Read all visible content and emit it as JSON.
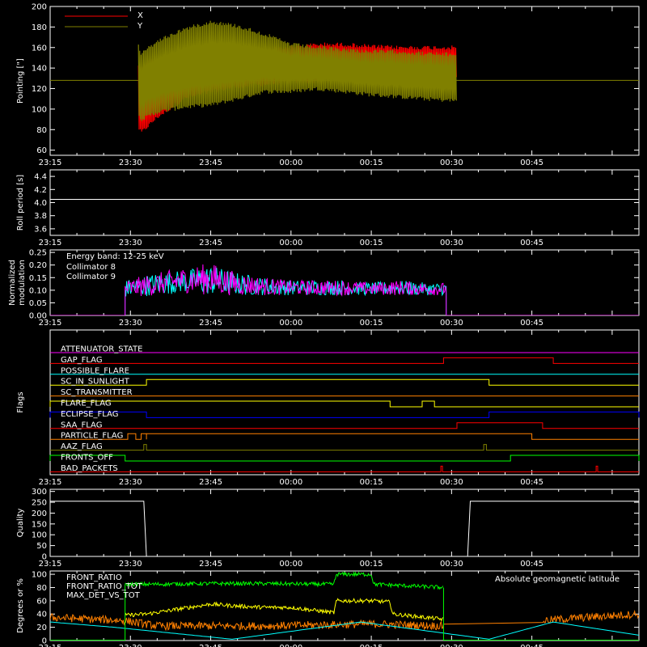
{
  "time_ticks": [
    "23:15",
    "23:30",
    "23:45",
    "00:00",
    "00:15",
    "00:30",
    "00:45"
  ],
  "chart_data": [
    {
      "type": "line",
      "ylabel": "Pointing [\"]",
      "ylim": [
        55,
        200
      ],
      "yticks": [
        60,
        80,
        100,
        120,
        140,
        160,
        180,
        200
      ],
      "xlim_minutes": [
        0,
        110
      ],
      "legend_placement": "top-left",
      "reference_line": 128,
      "series": [
        {
          "name": "X",
          "color": "#ff0000",
          "envelope": {
            "t": [
              16.5,
              17,
              18,
              20,
              25,
              30,
              35,
              40,
              45,
              50,
              55,
              60,
              65,
              70,
              76
            ],
            "low": [
              80,
              75,
              80,
              90,
              108,
              115,
              120,
              122,
              125,
              125,
              128,
              126,
              125,
              125,
              128
            ],
            "high": [
              145,
              140,
              148,
              150,
              150,
              152,
              158,
              160,
              162,
              165,
              165,
              163,
              162,
              162,
              162
            ]
          }
        },
        {
          "name": "Y",
          "color": "#808000",
          "envelope": {
            "t": [
              16.5,
              17,
              18,
              20,
              25,
              30,
              35,
              40,
              45,
              50,
              55,
              60,
              65,
              70,
              76
            ],
            "low": [
              95,
              88,
              90,
              95,
              100,
              102,
              108,
              115,
              115,
              118,
              115,
              112,
              110,
              108,
              106
            ],
            "high": [
              165,
              155,
              160,
              168,
              180,
              187,
              183,
              175,
              165,
              162,
              160,
              158,
              158,
              156,
              155
            ]
          }
        }
      ]
    },
    {
      "type": "line",
      "ylabel": "Roll period [s]",
      "ylim": [
        3.5,
        4.5
      ],
      "yticks": [
        3.6,
        3.8,
        4.0,
        4.2,
        4.4
      ],
      "xlim_minutes": [
        0,
        110
      ],
      "series": [
        {
          "name": "",
          "color": "#ffffff",
          "t": [
            0,
            110
          ],
          "values": [
            4.05,
            4.05
          ]
        }
      ]
    },
    {
      "type": "line",
      "ylabel": "Normalized modulation",
      "ylim": [
        0,
        0.26
      ],
      "yticks": [
        0.0,
        0.05,
        0.1,
        0.15,
        0.2,
        0.25
      ],
      "xlim_minutes": [
        0,
        110
      ],
      "legend_placement": "top-left",
      "annotation": "Energy band: 12-25 keV",
      "series": [
        {
          "name": "Collimator 8",
          "color": "#00ffff",
          "envelope": {
            "t": [
              14,
              20,
              25,
              30,
              35,
              40,
              45,
              50,
              55,
              60,
              65,
              70,
              74
            ],
            "low": [
              0.07,
              0.08,
              0.09,
              0.08,
              0.08,
              0.08,
              0.08,
              0.08,
              0.08,
              0.08,
              0.08,
              0.08,
              0.08
            ],
            "high": [
              0.14,
              0.17,
              0.18,
              0.2,
              0.17,
              0.15,
              0.14,
              0.14,
              0.14,
              0.13,
              0.14,
              0.13,
              0.13
            ]
          }
        },
        {
          "name": "Collimator 9",
          "color": "#ff00ff",
          "envelope": {
            "t": [
              14,
              20,
              25,
              30,
              35,
              40,
              45,
              50,
              55,
              60,
              65,
              70,
              74
            ],
            "low": [
              0.07,
              0.08,
              0.09,
              0.08,
              0.08,
              0.08,
              0.08,
              0.08,
              0.08,
              0.08,
              0.08,
              0.08,
              0.08
            ],
            "high": [
              0.14,
              0.17,
              0.19,
              0.21,
              0.17,
              0.15,
              0.14,
              0.14,
              0.14,
              0.13,
              0.14,
              0.13,
              0.13
            ]
          }
        }
      ]
    },
    {
      "type": "line",
      "ylabel": "Flags",
      "xlim_minutes": [
        0,
        110
      ],
      "series": [
        {
          "name": "ATTENUATOR_STATE",
          "color": "#ff00ff",
          "intervals": []
        },
        {
          "name": "GAP_FLAG",
          "color": "#ff0000",
          "intervals": [
            [
              73.5,
              94
            ]
          ]
        },
        {
          "name": "POSSIBLE_FLARE",
          "color": "#00ffff",
          "intervals": []
        },
        {
          "name": "SC_IN_SUNLIGHT",
          "color": "#ffff00",
          "intervals": [
            [
              18,
              82
            ]
          ]
        },
        {
          "name": "SC_TRANSMITTER",
          "color": "#ff8000",
          "intervals": []
        },
        {
          "name": "FLARE_FLAG",
          "color": "#ffff00",
          "intervals": [
            [
              0,
              63.5
            ],
            [
              69.5,
              71.8
            ]
          ]
        },
        {
          "name": "ECLIPSE_FLAG",
          "color": "#0000ff",
          "intervals": [
            [
              0,
              18
            ],
            [
              82,
              110
            ]
          ]
        },
        {
          "name": "SAA_FLAG",
          "color": "#ff0000",
          "intervals": [
            [
              76,
              92
            ]
          ]
        },
        {
          "name": "PARTICLE_FLAG",
          "color": "#ff8000",
          "intervals": [
            [
              14.5,
              16
            ],
            [
              17,
              18
            ],
            [
              18,
              90
            ]
          ]
        },
        {
          "name": "AAZ_FLAG",
          "color": "#808000",
          "intervals": [
            [
              17.5,
              18
            ],
            [
              81,
              81.5
            ]
          ]
        },
        {
          "name": "FRONTS_OFF",
          "color": "#00ff00",
          "intervals": [
            [
              0,
              14
            ],
            [
              86,
              110
            ]
          ]
        },
        {
          "name": "BAD_PACKETS",
          "color": "#ff0000",
          "intervals": [
            [
              73,
              73.3
            ],
            [
              102,
              102.3
            ]
          ]
        }
      ]
    },
    {
      "type": "line",
      "ylabel": "Quality",
      "ylim": [
        0,
        310
      ],
      "yticks": [
        0,
        50,
        100,
        150,
        200,
        250,
        300
      ],
      "xlim_minutes": [
        0,
        110
      ],
      "series": [
        {
          "name": "",
          "color": "#ffffff",
          "t": [
            0,
            17.5,
            18,
            78,
            78.5,
            110
          ],
          "values": [
            255,
            255,
            0,
            0,
            255,
            255
          ]
        }
      ]
    },
    {
      "type": "line",
      "ylabel": "Degrees or %",
      "ylim": [
        0,
        105
      ],
      "yticks": [
        0,
        20,
        40,
        60,
        80,
        100
      ],
      "xlim_minutes": [
        0,
        110
      ],
      "legend_placement": "top-left",
      "series": [
        {
          "name": "FRONT_RATIO",
          "color": "#ffff00",
          "t": [
            14,
            18,
            22,
            26,
            30,
            35,
            40,
            45,
            50,
            53,
            53.5,
            60,
            63.5,
            64,
            70,
            73.5
          ],
          "values": [
            38,
            40,
            45,
            50,
            55,
            52,
            50,
            50,
            45,
            42,
            60,
            60,
            58,
            40,
            35,
            32
          ]
        },
        {
          "name": "FRONT_RATIO_TOT",
          "color": "#00ff00",
          "t": [
            14,
            20,
            30,
            40,
            50,
            53,
            53.5,
            60,
            60.5,
            73.5
          ],
          "values": [
            85,
            85,
            86,
            86,
            85,
            85,
            100,
            100,
            85,
            80
          ]
        },
        {
          "name": "MAX_DET_VS_TOT",
          "color": "#ff8000",
          "t": [
            0,
            14,
            20,
            40,
            60,
            73.5,
            92,
            100,
            110
          ],
          "values": [
            35,
            30,
            22,
            22,
            25,
            22,
            30,
            35,
            40
          ]
        },
        {
          "name": "Absolute geomagnetic latitude",
          "color": "#00ffff",
          "t": [
            0,
            12,
            34,
            58,
            82,
            94,
            110
          ],
          "values": [
            28,
            20,
            2,
            28,
            2,
            28,
            8
          ]
        }
      ]
    }
  ]
}
